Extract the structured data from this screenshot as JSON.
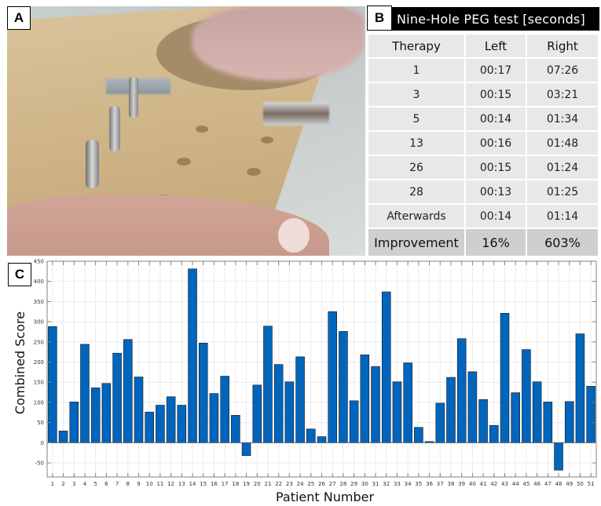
{
  "panels": {
    "a": {
      "label": "A",
      "image_description": "Wooden nine-hole peg board with metal pegs, hand placing pegs"
    },
    "b": {
      "label": "B"
    },
    "c": {
      "label": "C"
    }
  },
  "table": {
    "title": "Nine-Hole PEG test [seconds]",
    "headers": [
      "Therapy",
      "Left",
      "Right"
    ],
    "rows": [
      [
        "1",
        "00:17",
        "07:26"
      ],
      [
        "3",
        "00:15",
        "03:21"
      ],
      [
        "5",
        "00:14",
        "01:34"
      ],
      [
        "13",
        "00:16",
        "01:48"
      ],
      [
        "26",
        "00:15",
        "01:24"
      ],
      [
        "28",
        "00:13",
        "01:25"
      ],
      [
        "Afterwards",
        "00:14",
        "01:14"
      ]
    ],
    "improvement": [
      "Improvement",
      "16%",
      "603%"
    ]
  },
  "colors": {
    "bar": "#0065bd",
    "bar_edge": "#1a1a1a",
    "grid": "#ebebeb",
    "axis": "#808080"
  },
  "chart_data": {
    "type": "bar",
    "title": "",
    "xlabel": "Patient Number",
    "ylabel": "Combined Score",
    "ylim": [
      -85,
      450
    ],
    "yticks": [
      -50,
      0,
      50,
      100,
      150,
      200,
      250,
      300,
      350,
      400,
      450
    ],
    "grid": true,
    "legend": "none",
    "categories": [
      "1",
      "2",
      "3",
      "4",
      "5",
      "6",
      "7",
      "8",
      "9",
      "10",
      "11",
      "12",
      "13",
      "14",
      "15",
      "16",
      "17",
      "18",
      "19",
      "20",
      "21",
      "22",
      "23",
      "24",
      "25",
      "26",
      "27",
      "28",
      "29",
      "30",
      "31",
      "32",
      "33",
      "34",
      "35",
      "36",
      "37",
      "38",
      "39",
      "40",
      "41",
      "42",
      "43",
      "44",
      "45",
      "46",
      "47",
      "48",
      "49",
      "50",
      "51"
    ],
    "values": [
      288,
      29,
      101,
      244,
      136,
      147,
      222,
      256,
      163,
      76,
      93,
      114,
      93,
      431,
      247,
      122,
      165,
      68,
      -32,
      143,
      289,
      194,
      151,
      213,
      34,
      15,
      325,
      276,
      104,
      218,
      189,
      374,
      151,
      198,
      38,
      3,
      98,
      162,
      258,
      176,
      107,
      43,
      321,
      124,
      231,
      151,
      101,
      -68,
      102,
      270,
      140
    ]
  }
}
